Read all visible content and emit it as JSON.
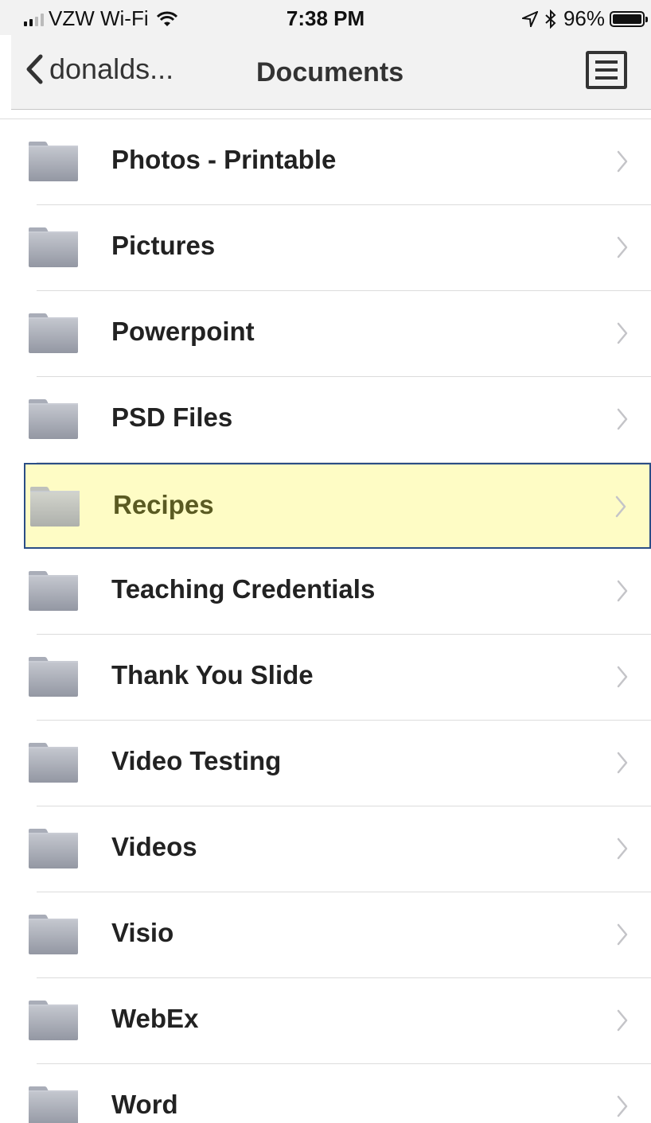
{
  "status_bar": {
    "carrier": "VZW Wi-Fi",
    "time": "7:38 PM",
    "battery": "96%",
    "battery_level": 0.96
  },
  "nav": {
    "back_label": "donalds...",
    "title": "Documents",
    "menu_icon": "list-menu-icon"
  },
  "folders": [
    {
      "name": "Photos - Printable",
      "selected": false
    },
    {
      "name": "Pictures",
      "selected": false
    },
    {
      "name": "Powerpoint",
      "selected": false
    },
    {
      "name": "PSD Files",
      "selected": false
    },
    {
      "name": "Recipes",
      "selected": true
    },
    {
      "name": "Teaching Credentials",
      "selected": false
    },
    {
      "name": "Thank You Slide",
      "selected": false
    },
    {
      "name": "Video Testing",
      "selected": false
    },
    {
      "name": "Videos",
      "selected": false
    },
    {
      "name": "Visio",
      "selected": false
    },
    {
      "name": "WebEx",
      "selected": false
    },
    {
      "name": "Word",
      "selected": false
    }
  ],
  "colors": {
    "selected_background": "#fefcc5",
    "selected_border": "#2a4d86",
    "bar_background": "#f2f2f2"
  }
}
